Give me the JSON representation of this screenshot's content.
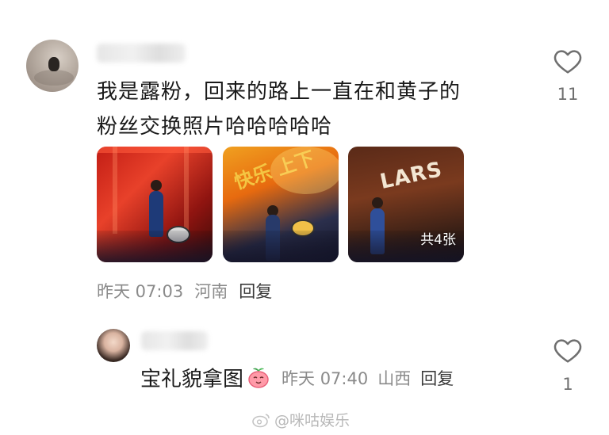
{
  "comments": [
    {
      "text_line1": "我是露粉，回来的路上一直在和黄子的",
      "text_line2": "粉丝交换照片哈哈哈哈哈",
      "likes": "11",
      "time": "昨天 07:03",
      "location": "河南",
      "reply_label": "回复",
      "photos": [
        {
          "icon": "concert-photo-red-stage"
        },
        {
          "icon": "concert-photo-orange-stage",
          "overlay_text": "快乐 上下"
        },
        {
          "icon": "concert-photo-brown-stage",
          "overlay_text": "LARS",
          "badge": "共4张"
        }
      ]
    },
    {
      "text": "宝礼貌拿图",
      "emoji": "peach-smile-icon",
      "likes": "1",
      "time": "昨天 07:40",
      "location": "山西",
      "reply_label": "回复"
    }
  ],
  "watermark": "@咪咕娱乐",
  "colors": {
    "text": "#1a1a1a",
    "meta": "#8a8a8a",
    "heart_outline": "#6f6f6f"
  }
}
